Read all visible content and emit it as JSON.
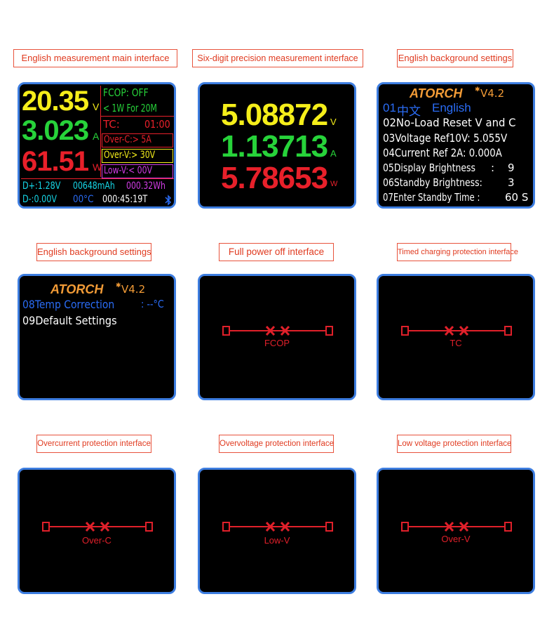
{
  "captions": {
    "c1": "English measurement main interface",
    "c2": "Six-digit precision measurement interface",
    "c3": "English background settings",
    "c4": "English background settings",
    "c5": "Full power off interface",
    "c6": "Timed charging protection interface",
    "c7": "Overcurrent protection interface",
    "c8": "Overvoltage protection interface",
    "c9": "Low voltage protection interface"
  },
  "main": {
    "voltage": "20.35",
    "voltage_unit": "V",
    "current": "3.023",
    "current_unit": "A",
    "power": "61.51",
    "power_unit": "W",
    "fcop": "FCOP: OFF",
    "fcop_rule": "< 1W For 20M",
    "tc_label": "TC:",
    "tc_value": "01:00",
    "over_c": "Over-C:> 5A",
    "over_v": "Over-V:> 30V",
    "low_v": "Low-V:< 00V",
    "dplus": "D+:1.28V",
    "mah": "00648mAh",
    "wh": "000.32Wh",
    "dminus": "D-:0.00V",
    "temp": "00°C",
    "time": "000:45:19T",
    "bt_icon": "bluetooth-icon"
  },
  "precision": {
    "voltage": "5.08872",
    "voltage_unit": "V",
    "current": "1.13713",
    "current_unit": "A",
    "power": "5.78653",
    "power_unit": "W"
  },
  "settings1": {
    "logo": "ATORCH",
    "version": "V4.2",
    "item01_num": "01",
    "item01_cn": "中文",
    "item01_en": "English",
    "item02": "02No-Load Reset V and C",
    "item03": "03Voltage  Ref10V: 5.055V",
    "item04": "04Current  Ref  2A: 0.000A",
    "item05_label": "05Display Brightness",
    "item05_sep": ":",
    "item05_value": "9",
    "item06_label": "06Standby Brightness:",
    "item06_value": "3",
    "item07_label": "07Enter Standby Time :",
    "item07_value": "60 S"
  },
  "settings2": {
    "logo": "ATORCH",
    "version": "V4.2",
    "item08_label": "08Temp Correction",
    "item08_value": ": --°C",
    "item09": "09Default Settings"
  },
  "protection": [
    {
      "label": "FCOP"
    },
    {
      "label": "TC"
    },
    {
      "label": "Over-C"
    },
    {
      "label": "Low-V"
    },
    {
      "label": "Over-V"
    }
  ],
  "colors": {
    "caption_border": "#e8533c",
    "screen_border": "#3d7de0",
    "yellow": "#f5ee1a",
    "green": "#27d33a",
    "red": "#e8202a",
    "cyan": "#16d6e6",
    "blue": "#2a6cf5",
    "magenta": "#d23ce6",
    "orange": "#f29b36",
    "prot_red": "#e0202a"
  }
}
